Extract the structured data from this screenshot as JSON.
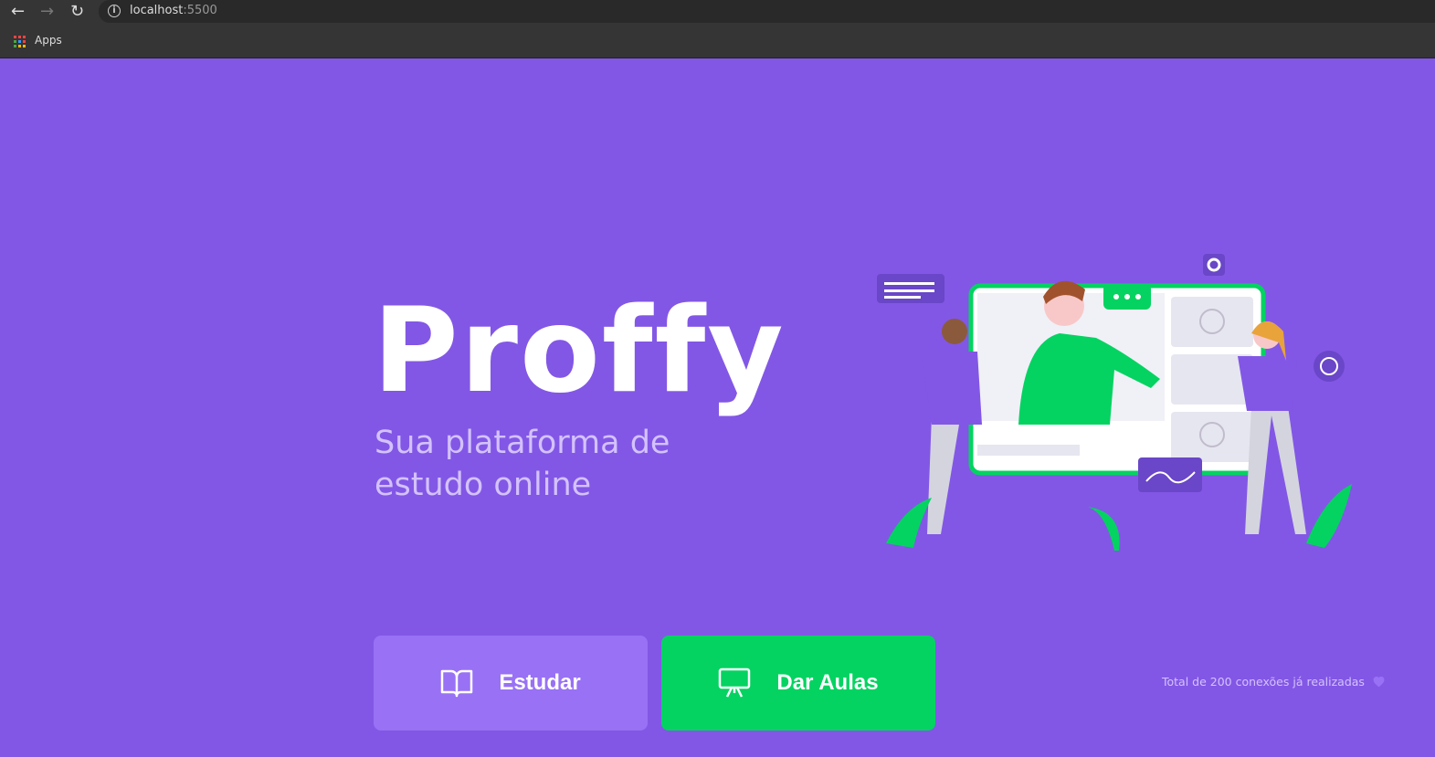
{
  "browser": {
    "url_host": "localhost",
    "url_port": ":5500",
    "bookmarks": [
      {
        "label": "Apps"
      }
    ]
  },
  "hero": {
    "logo": "Proffy",
    "tagline": "Sua plataforma de estudo online"
  },
  "actions": {
    "study_label": "Estudar",
    "teach_label": "Dar Aulas"
  },
  "footer": {
    "connections": "Total de 200 conexões já realizadas"
  },
  "colors": {
    "background": "#8257E5",
    "study": "#9871F5",
    "teach": "#04D361",
    "text_soft": "#D4C2FF"
  }
}
